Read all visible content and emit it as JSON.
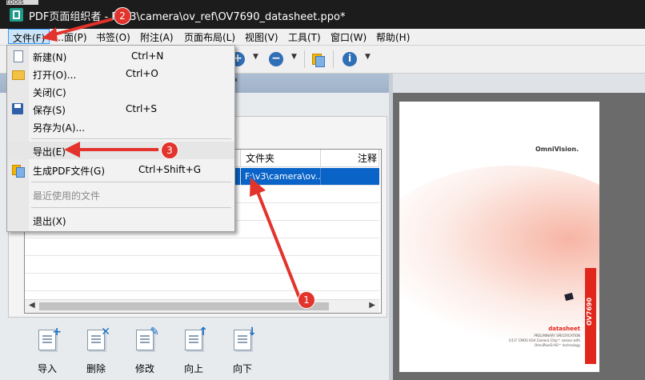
{
  "window": {
    "top_strip_text": "tools",
    "title": "PDF页面组织者 - F:\\v3\\camera\\ov_ref\\OV7690_datasheet.ppo*"
  },
  "menubar": [
    {
      "label": "文件(F)"
    },
    {
      "label": "…面(P)"
    },
    {
      "label": "书签(O)"
    },
    {
      "label": "附注(A)"
    },
    {
      "label": "页面布局(L)"
    },
    {
      "label": "视图(V)"
    },
    {
      "label": "工具(T)"
    },
    {
      "label": "窗口(W)"
    },
    {
      "label": "帮助(H)"
    }
  ],
  "file_menu": {
    "items": [
      {
        "label": "新建(N)",
        "shortcut": "Ctrl+N",
        "icon": "new-file-icon"
      },
      {
        "label": "打开(O)...",
        "shortcut": "Ctrl+O",
        "icon": "open-folder-icon"
      },
      {
        "label": "关闭(C)",
        "shortcut": ""
      },
      {
        "label": "保存(S)",
        "shortcut": "Ctrl+S",
        "icon": "save-disk-icon"
      },
      {
        "label": "另存为(A)...",
        "shortcut": ""
      },
      {
        "label": "导出(E)",
        "shortcut": ""
      },
      {
        "label": "生成PDF文件(G)",
        "shortcut": "Ctrl+Shift+G",
        "icon": "generate-pdf-icon"
      },
      {
        "label": "最近使用的文件",
        "shortcut": "",
        "disabled": true
      },
      {
        "label": "退出(X)",
        "shortcut": ""
      }
    ]
  },
  "document_tab": {
    "label": "*"
  },
  "file_table": {
    "columns": [
      "",
      "",
      "",
      "",
      "文件夹",
      "注释"
    ],
    "selected_row": {
      "folder": "F:\\v3\\camera\\ov..."
    }
  },
  "bottom_buttons": [
    {
      "label": "导入",
      "icon": "import-page-icon"
    },
    {
      "label": "删除",
      "icon": "delete-page-icon"
    },
    {
      "label": "修改",
      "icon": "edit-page-icon"
    },
    {
      "label": "向上",
      "icon": "move-up-icon"
    },
    {
      "label": "向下",
      "icon": "move-down-icon"
    }
  ],
  "preview": {
    "logo": "OmniVision.",
    "side_tab": "OV7690",
    "heading": "datasheet",
    "subheading": "PRELIMINARY SPECIFICATION",
    "description": "1/13\" CMOS VGA Camera Chip™ sensor with OmniPixel3-HS™ technology"
  },
  "annotations": {
    "badge_1": "1",
    "badge_2": "2",
    "badge_3": "3",
    "arrow_color": "#e2332c"
  }
}
